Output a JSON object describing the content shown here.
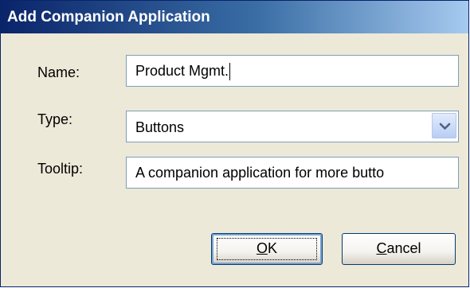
{
  "window": {
    "title": "Add Companion Application"
  },
  "form": {
    "name": {
      "label": "Name:",
      "value": "Product Mgmt."
    },
    "type": {
      "label": "Type:",
      "selected": "Buttons"
    },
    "tooltip": {
      "label": "Tooltip:",
      "value": "A companion application for more butto"
    }
  },
  "buttons": {
    "ok": {
      "mnemonic": "O",
      "rest": "K"
    },
    "cancel": {
      "mnemonic": "C",
      "rest": "ancel"
    }
  },
  "icons": {
    "dropdown": "chevron-down-icon"
  },
  "colors": {
    "title_bar": "#0A246A",
    "dialog_background": "#ECE9D8",
    "field_border": "#7F9DB9",
    "button_border": "#003C74"
  }
}
